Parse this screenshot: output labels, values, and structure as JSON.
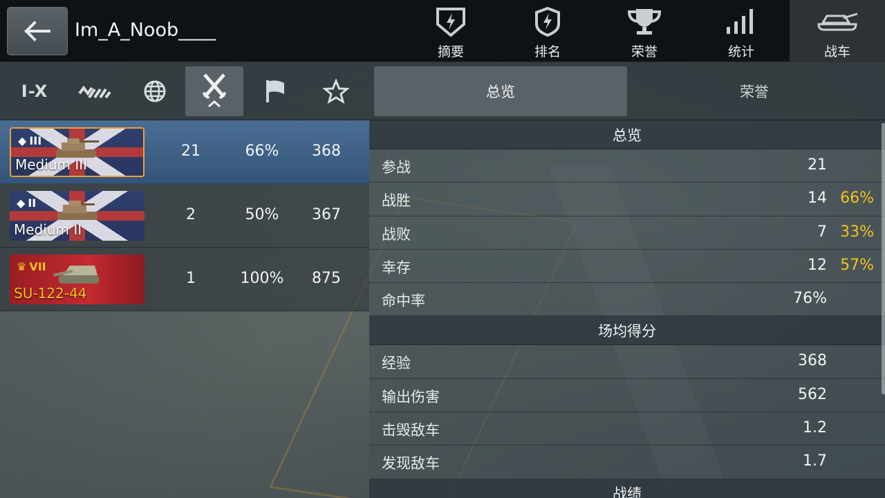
{
  "header": {
    "back_icon": "arrow-left-icon",
    "player_name": "Im_A_Noob____",
    "tabs": [
      {
        "label": "摘要",
        "icon": "shield-bolt-icon"
      },
      {
        "label": "排名",
        "icon": "badge-bolt-icon"
      },
      {
        "label": "荣誉",
        "icon": "trophy-icon"
      },
      {
        "label": "统计",
        "icon": "bars-icon"
      },
      {
        "label": "战车",
        "icon": "tank-icon",
        "active": true
      }
    ]
  },
  "filters": [
    {
      "label": "I-X",
      "icon": "tier-text"
    },
    {
      "label": "",
      "icon": "chevrons-icon"
    },
    {
      "label": "",
      "icon": "globe-icon"
    },
    {
      "label": "",
      "icon": "crossed-swords-icon",
      "active": true
    },
    {
      "label": "",
      "icon": "flag-icon"
    },
    {
      "label": "",
      "icon": "star-icon"
    }
  ],
  "vehicles": [
    {
      "tier": "III",
      "name": "Medium III",
      "nation": "uk",
      "battles": "21",
      "winrate": "66%",
      "avg_xp": "368",
      "selected": true
    },
    {
      "tier": "II",
      "name": "Medium II",
      "nation": "uk",
      "battles": "2",
      "winrate": "50%",
      "avg_xp": "367"
    },
    {
      "tier": "VII",
      "name": "SU-122-44",
      "nation": "ussr",
      "premium": true,
      "battles": "1",
      "winrate": "100%",
      "avg_xp": "875"
    }
  ],
  "right_tabs": {
    "overview": "总览",
    "honors": "荣誉"
  },
  "sections": [
    {
      "title": "总览",
      "rows": [
        {
          "label": "参战",
          "value": "21",
          "pct": ""
        },
        {
          "label": "战胜",
          "value": "14",
          "pct": "66%"
        },
        {
          "label": "战败",
          "value": "7",
          "pct": "33%"
        },
        {
          "label": "幸存",
          "value": "12",
          "pct": "57%"
        },
        {
          "label": "命中率",
          "value": "76%",
          "pct": ""
        }
      ]
    },
    {
      "title": "场均得分",
      "rows": [
        {
          "label": "经验",
          "value": "368",
          "pct": ""
        },
        {
          "label": "输出伤害",
          "value": "562",
          "pct": ""
        },
        {
          "label": "击毁敌车",
          "value": "1.2",
          "pct": ""
        },
        {
          "label": "发现敌车",
          "value": "1.7",
          "pct": ""
        }
      ]
    },
    {
      "title": "战绩",
      "rows": []
    }
  ],
  "colors": {
    "accent_gold": "#f1c31b",
    "selected_border": "#e9a23b",
    "selected_row": "#4b6e95"
  }
}
